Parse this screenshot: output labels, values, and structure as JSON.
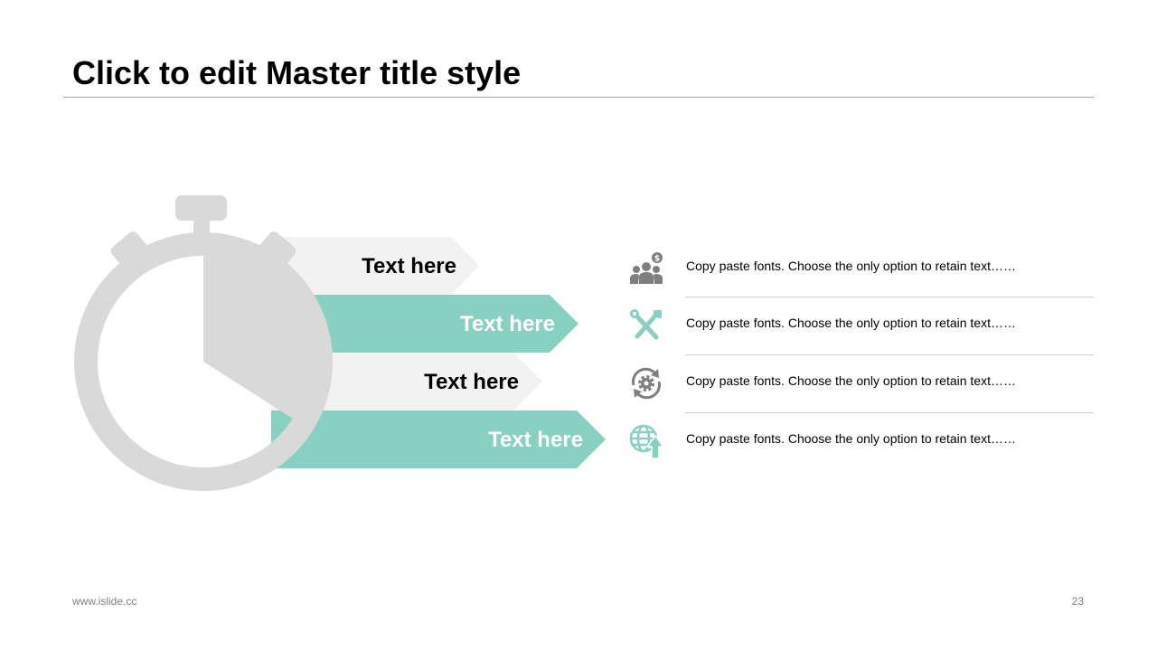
{
  "title": "Click to edit Master title style",
  "colors": {
    "accent": "#88d0c1",
    "gray": "#d9d9d9",
    "light_gray": "#f2f2f2",
    "icon_gray": "#7f7f7f"
  },
  "arrows": [
    {
      "label": "Text here",
      "style": "light"
    },
    {
      "label": "Text here",
      "style": "accent"
    },
    {
      "label": "Text here",
      "style": "light"
    },
    {
      "label": "Text here",
      "style": "accent"
    }
  ],
  "items": [
    {
      "icon": "team-money-icon",
      "text": "Copy paste fonts. Choose the only option to retain text……"
    },
    {
      "icon": "tools-icon",
      "text": "Copy paste fonts. Choose the only option to retain text……"
    },
    {
      "icon": "gear-cycle-icon",
      "text": "Copy paste fonts. Choose the only option to retain text……"
    },
    {
      "icon": "globe-upload-icon",
      "text": "Copy paste fonts. Choose the only option to retain text……"
    }
  ],
  "footer": {
    "website": "www.islide.cc",
    "page_number": "23"
  }
}
